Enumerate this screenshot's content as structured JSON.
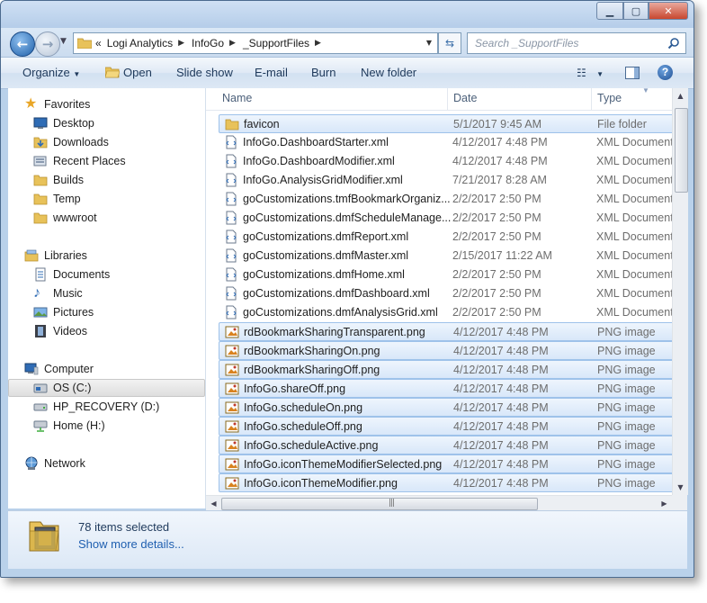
{
  "window": {
    "minimize_icon": "minimize-icon",
    "maximize_icon": "maximize-icon",
    "close_icon": "close-icon"
  },
  "address": {
    "overflow": "«",
    "crumbs": [
      "Logi Analytics",
      "InfoGo",
      "_SupportFiles"
    ]
  },
  "search": {
    "placeholder": "Search _SupportFiles"
  },
  "toolbar": {
    "organize": "Organize",
    "open": "Open",
    "slideshow": "Slide show",
    "email": "E-mail",
    "burn": "Burn",
    "new_folder": "New folder"
  },
  "nav": {
    "favorites": "Favorites",
    "desktop": "Desktop",
    "downloads": "Downloads",
    "recent": "Recent Places",
    "builds": "Builds",
    "temp": "Temp",
    "wwwroot": "wwwroot",
    "libraries": "Libraries",
    "documents": "Documents",
    "music": "Music",
    "pictures": "Pictures",
    "videos": "Videos",
    "computer": "Computer",
    "os": "OS (C:)",
    "recovery": "HP_RECOVERY (D:)",
    "home": "Home (H:)",
    "network": "Network"
  },
  "columns": {
    "name": "Name",
    "date": "Date",
    "type": "Type"
  },
  "files": [
    {
      "name": "favicon",
      "date": "5/1/2017 9:45 AM",
      "type": "File folder",
      "kind": "folder",
      "selected": true
    },
    {
      "name": "InfoGo.DashboardStarter.xml",
      "date": "4/12/2017 4:48 PM",
      "type": "XML Document",
      "kind": "xml",
      "selected": false
    },
    {
      "name": "InfoGo.DashboardModifier.xml",
      "date": "4/12/2017 4:48 PM",
      "type": "XML Document",
      "kind": "xml",
      "selected": false
    },
    {
      "name": "InfoGo.AnalysisGridModifier.xml",
      "date": "7/21/2017 8:28 AM",
      "type": "XML Document",
      "kind": "xml",
      "selected": false
    },
    {
      "name": "goCustomizations.tmfBookmarkOrganiz...",
      "date": "2/2/2017 2:50 PM",
      "type": "XML Document",
      "kind": "xml",
      "selected": false
    },
    {
      "name": "goCustomizations.dmfScheduleManage...",
      "date": "2/2/2017 2:50 PM",
      "type": "XML Document",
      "kind": "xml",
      "selected": false
    },
    {
      "name": "goCustomizations.dmfReport.xml",
      "date": "2/2/2017 2:50 PM",
      "type": "XML Document",
      "kind": "xml",
      "selected": false
    },
    {
      "name": "goCustomizations.dmfMaster.xml",
      "date": "2/15/2017 11:22 AM",
      "type": "XML Document",
      "kind": "xml",
      "selected": false
    },
    {
      "name": "goCustomizations.dmfHome.xml",
      "date": "2/2/2017 2:50 PM",
      "type": "XML Document",
      "kind": "xml",
      "selected": false
    },
    {
      "name": "goCustomizations.dmfDashboard.xml",
      "date": "2/2/2017 2:50 PM",
      "type": "XML Document",
      "kind": "xml",
      "selected": false
    },
    {
      "name": "goCustomizations.dmfAnalysisGrid.xml",
      "date": "2/2/2017 2:50 PM",
      "type": "XML Document",
      "kind": "xml",
      "selected": false
    },
    {
      "name": "rdBookmarkSharingTransparent.png",
      "date": "4/12/2017 4:48 PM",
      "type": "PNG image",
      "kind": "png",
      "selected": true
    },
    {
      "name": "rdBookmarkSharingOn.png",
      "date": "4/12/2017 4:48 PM",
      "type": "PNG image",
      "kind": "png",
      "selected": true
    },
    {
      "name": "rdBookmarkSharingOff.png",
      "date": "4/12/2017 4:48 PM",
      "type": "PNG image",
      "kind": "png",
      "selected": true
    },
    {
      "name": "InfoGo.shareOff.png",
      "date": "4/12/2017 4:48 PM",
      "type": "PNG image",
      "kind": "png",
      "selected": true
    },
    {
      "name": "InfoGo.scheduleOn.png",
      "date": "4/12/2017 4:48 PM",
      "type": "PNG image",
      "kind": "png",
      "selected": true
    },
    {
      "name": "InfoGo.scheduleOff.png",
      "date": "4/12/2017 4:48 PM",
      "type": "PNG image",
      "kind": "png",
      "selected": true
    },
    {
      "name": "InfoGo.scheduleActive.png",
      "date": "4/12/2017 4:48 PM",
      "type": "PNG image",
      "kind": "png",
      "selected": true
    },
    {
      "name": "InfoGo.iconThemeModifierSelected.png",
      "date": "4/12/2017 4:48 PM",
      "type": "PNG image",
      "kind": "png",
      "selected": true
    },
    {
      "name": "InfoGo.iconThemeModifier.png",
      "date": "4/12/2017 4:48 PM",
      "type": "PNG image",
      "kind": "png",
      "selected": true
    }
  ],
  "details": {
    "count": "78 items selected",
    "more": "Show more details..."
  }
}
